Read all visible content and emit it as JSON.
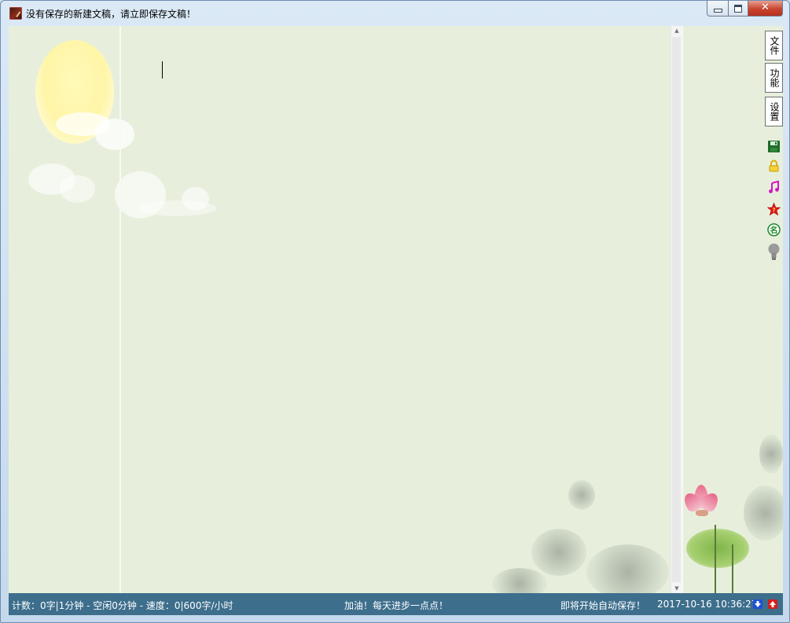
{
  "window": {
    "title": "没有保存的新建文稿，请立即保存文稿！",
    "close_glyph": "✕"
  },
  "sidebar": {
    "buttons": [
      {
        "label": "文件"
      },
      {
        "label": "功能"
      },
      {
        "label": "设置"
      }
    ],
    "icons": [
      "save-icon",
      "lock-icon",
      "music-icon",
      "star-icon",
      "name-icon",
      "bulb-icon"
    ],
    "name_icon_glyph": "名"
  },
  "statusbar": {
    "stats": "计数：0字|1分钟 - 空闲0分钟 - 速度：0|600字/小时",
    "motto": "加油！每天进步一点点！",
    "autosave": "即将开始自动保存！",
    "datetime": "2017-10-16  10:36:27"
  },
  "colors": {
    "status_bg": "#3d6e8c",
    "paper_bg": "#e7efdc"
  }
}
